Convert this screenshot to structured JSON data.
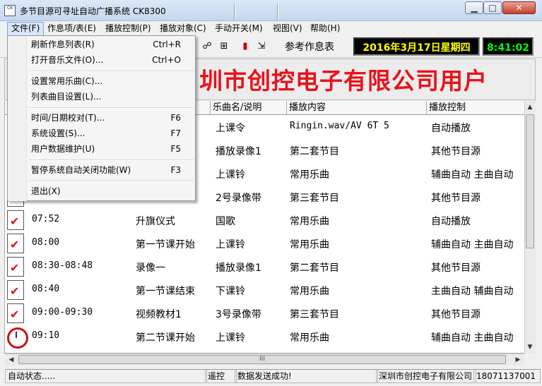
{
  "window": {
    "title": "多节目源可寻址自动广播系统 CK8300",
    "icon_text": "CK"
  },
  "menubar": [
    "文件(F)",
    "作息项/表(E)",
    "播放控制(P)",
    "播放对象(C)",
    "手动开关(M)",
    "视图(V)",
    "帮助(H)"
  ],
  "file_menu": [
    {
      "label": "刷新作息列表(R)",
      "shortcut": "Ctrl+R"
    },
    {
      "label": "打开音乐文件(O)...",
      "shortcut": "Ctrl+O"
    },
    {
      "label": "设置常用乐曲(C)...",
      "shortcut": ""
    },
    {
      "label": "列表曲目设置(L)...",
      "shortcut": ""
    },
    {
      "label": "时间/日期校对(T)...",
      "shortcut": "F6"
    },
    {
      "label": "系统设置(S)...",
      "shortcut": "F7"
    },
    {
      "label": "用户数据维护(U)",
      "shortcut": "F5"
    },
    {
      "label": "暂停系统自动关闭功能(W)",
      "shortcut": "F3"
    },
    {
      "label": "退出(X)",
      "shortcut": ""
    }
  ],
  "toolbar": {
    "ref_label": "参考作息表",
    "date": "2016年3月17日星期四",
    "time": "8:41:02"
  },
  "banner": {
    "text": "圳市创控电子有限公司用户"
  },
  "table": {
    "headers": [
      "乐曲名/说明",
      "播放内容",
      "播放控制"
    ],
    "rows": [
      {
        "time": "",
        "name": "",
        "music": "上课令",
        "content": "Ringin.wav/AV 6T 5",
        "control": "自动播放",
        "icon": "doc"
      },
      {
        "time": "",
        "name": "",
        "music": "播放录像1",
        "content": "第二套节目",
        "control": "其他节目源",
        "icon": "doc"
      },
      {
        "time": "",
        "name": "",
        "music": "上课铃",
        "content": "常用乐曲",
        "control": "辅曲自动 主曲自动",
        "icon": "doc"
      },
      {
        "time": "",
        "name": "",
        "music": "2号录像带",
        "content": "第三套节目",
        "control": "其他节目源",
        "icon": "doc"
      },
      {
        "time": "07:52",
        "name": "升旗仪式",
        "music": "国歌",
        "content": "常用乐曲",
        "control": "自动播放",
        "icon": "doc"
      },
      {
        "time": "08:00",
        "name": "第一节课开始",
        "music": "上课铃",
        "content": "常用乐曲",
        "control": "辅曲自动 主曲自动",
        "icon": "doc"
      },
      {
        "time": "08:30-08:48",
        "name": "录像一",
        "music": "播放录像1",
        "content": "第二套节目",
        "control": "其他节目源",
        "icon": "doc"
      },
      {
        "time": "08:40",
        "name": "第一节课结束",
        "music": "下课铃",
        "content": "常用乐曲",
        "control": "主曲自动 辅曲自动",
        "icon": "doc"
      },
      {
        "time": "09:00-09:30",
        "name": "视频教材1",
        "music": "3号录像带",
        "content": "第三套节目",
        "control": "其他节目源",
        "icon": "speaker"
      },
      {
        "time": "09:10",
        "name": "第二节课开始",
        "music": "上课铃",
        "content": "常用乐曲",
        "control": "辅曲自动 主曲自动",
        "icon": "clock"
      }
    ]
  },
  "status": {
    "state": "自动状态.....",
    "remote": "遥控",
    "message": "数据发送成功!",
    "company": "深圳市创控电子有限公司",
    "phone": "18071137001"
  },
  "hscroll_grip": "III"
}
